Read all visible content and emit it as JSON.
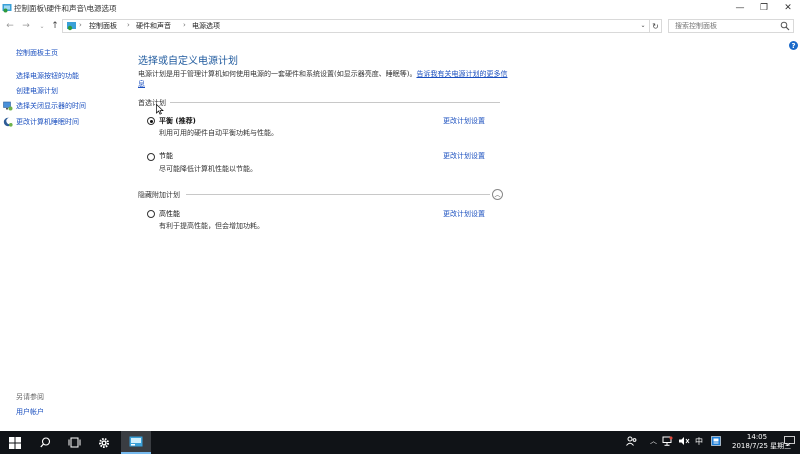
{
  "window": {
    "title": "控制面板\\硬件和声音\\电源选项",
    "controls": {
      "minimize": "—",
      "maximize": "❐",
      "close": "✕"
    }
  },
  "address": {
    "crumbs": [
      "控制面板",
      "硬件和声音",
      "电源选项"
    ],
    "search_placeholder": "搜索控制面板"
  },
  "sidebar": {
    "home": "控制面板主页",
    "items": [
      {
        "label": "选择电源按钮的功能",
        "icon": ""
      },
      {
        "label": "创建电源计划",
        "icon": ""
      },
      {
        "label": "选择关闭显示器的时间",
        "icon": "monitor-icon"
      },
      {
        "label": "更改计算机睡眠时间",
        "icon": "moon-icon"
      }
    ],
    "see_also": "另请参阅",
    "see_also_items": [
      "用户帐户"
    ]
  },
  "main": {
    "title": "选择或自定义电源计划",
    "desc": "电源计划是用于管理计算机如何使用电源的一套硬件和系统设置(如显示器亮度、睡眠等)。",
    "desc_link": "告诉我有关电源计划的更多信息",
    "preferred_label": "首选计划",
    "plans": [
      {
        "name": "平衡 (推荐)",
        "desc": "利用可用的硬件自动平衡功耗与性能。",
        "link": "更改计划设置",
        "selected": true
      },
      {
        "name": "节能",
        "desc": "尽可能降低计算机性能以节能。",
        "link": "更改计划设置",
        "selected": false
      }
    ],
    "hidden_label": "隐藏附加计划",
    "hidden_plans": [
      {
        "name": "高性能",
        "desc": "有利于提高性能，但会增加功耗。",
        "link": "更改计划设置",
        "selected": false
      }
    ]
  },
  "taskbar": {
    "ime": "中",
    "time": "14:05",
    "date": "2018/7/25 星期三"
  },
  "colors": {
    "accent": "#1f5a9e",
    "link": "#1a4fbf",
    "taskbar": "#101317"
  }
}
